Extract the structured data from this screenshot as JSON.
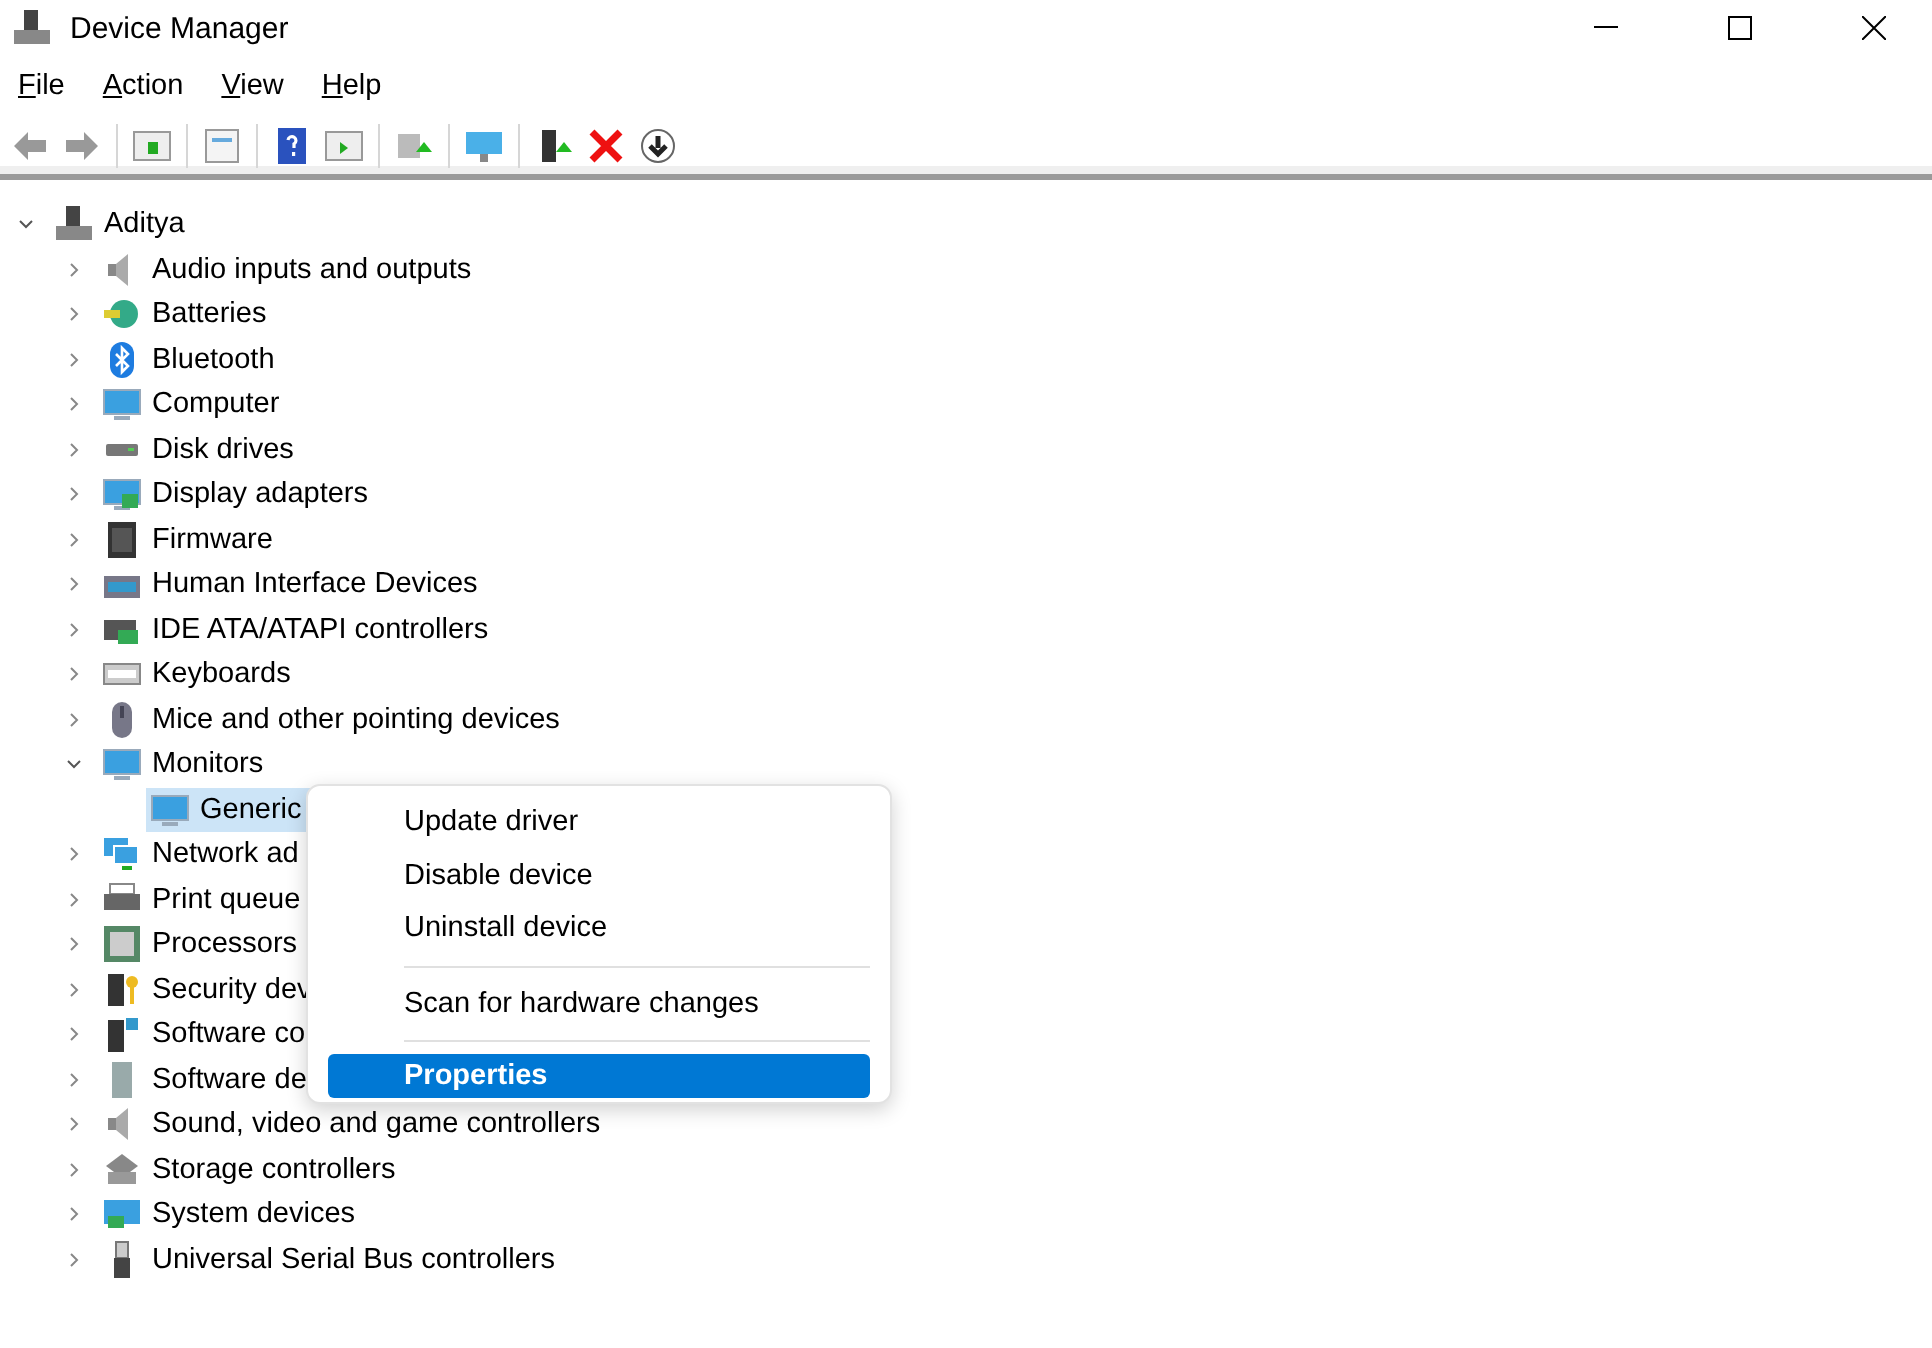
{
  "window": {
    "title": "Device Manager"
  },
  "menu_bar": [
    {
      "label": "File"
    },
    {
      "label": "Action"
    },
    {
      "label": "View"
    },
    {
      "label": "Help"
    }
  ],
  "tree": {
    "label": "Aditya",
    "expanded": true,
    "selected": false,
    "children": [
      {
        "label": "Audio inputs and outputs",
        "expanded": false,
        "selected": false
      },
      {
        "label": "Batteries",
        "expanded": false,
        "selected": false
      },
      {
        "label": "Bluetooth",
        "expanded": false,
        "selected": false
      },
      {
        "label": "Computer",
        "expanded": false,
        "selected": false
      },
      {
        "label": "Disk drives",
        "expanded": false,
        "selected": false
      },
      {
        "label": "Display adapters",
        "expanded": false,
        "selected": false
      },
      {
        "label": "Firmware",
        "expanded": false,
        "selected": false
      },
      {
        "label": "Human Interface Devices",
        "expanded": false,
        "selected": false
      },
      {
        "label": "IDE ATA/ATAPI controllers",
        "expanded": false,
        "selected": false
      },
      {
        "label": "Keyboards",
        "expanded": false,
        "selected": false
      },
      {
        "label": "Mice and other pointing devices",
        "expanded": false,
        "selected": false
      },
      {
        "label": "Monitors",
        "expanded": true,
        "selected": false,
        "children": [
          {
            "label": "Generic",
            "selected": true
          }
        ]
      },
      {
        "label": "Network ad",
        "expanded": false,
        "selected": false
      },
      {
        "label": "Print queue",
        "expanded": false,
        "selected": false
      },
      {
        "label": "Processors",
        "expanded": false,
        "selected": false
      },
      {
        "label": "Security dev",
        "expanded": false,
        "selected": false
      },
      {
        "label": "Software co",
        "expanded": false,
        "selected": false
      },
      {
        "label": "Software de",
        "expanded": false,
        "selected": false
      },
      {
        "label": "Sound, video and game controllers",
        "expanded": false,
        "selected": false
      },
      {
        "label": "Storage controllers",
        "expanded": false,
        "selected": false
      },
      {
        "label": "System devices",
        "expanded": false,
        "selected": false
      },
      {
        "label": "Universal Serial Bus controllers",
        "expanded": false,
        "selected": false
      }
    ]
  },
  "context_menu": [
    {
      "kind": "item",
      "label": "Update driver",
      "selected": false
    },
    {
      "kind": "item",
      "label": "Disable device",
      "selected": false
    },
    {
      "kind": "item",
      "label": "Uninstall device",
      "selected": false
    },
    {
      "kind": "separator"
    },
    {
      "kind": "item",
      "label": "Scan for hardware changes",
      "selected": false
    },
    {
      "kind": "separator"
    },
    {
      "kind": "item",
      "label": "Properties",
      "selected": true
    }
  ]
}
